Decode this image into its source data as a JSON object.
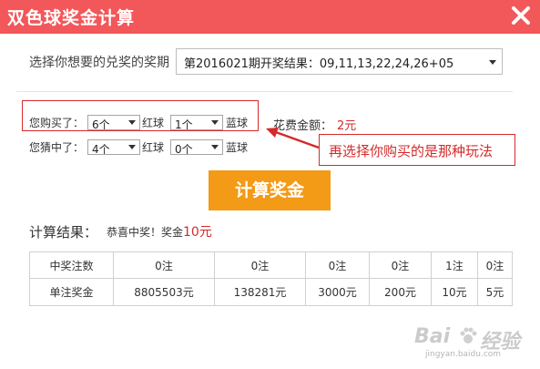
{
  "dialog": {
    "title": "双色球奖金计算",
    "close_icon": "close-icon"
  },
  "period": {
    "label": "选择你想要的兑奖的奖期",
    "selected": "第2016021期开奖结果：09,11,13,22,24,26+05"
  },
  "bought": {
    "label": "您购买了：",
    "red_value": "6个",
    "red_unit": "红球",
    "blue_value": "1个",
    "blue_unit": "蓝球"
  },
  "matched": {
    "label": "您猜中了：",
    "red_value": "4个",
    "red_unit": "红球",
    "blue_value": "0个",
    "blue_unit": "蓝球"
  },
  "cost": {
    "label": "花费金额：",
    "value": "2元"
  },
  "annotation": {
    "text": "再选择你购买的是那种玩法",
    "color": "#d62a2a"
  },
  "calculate_button": {
    "label": "计算奖金",
    "color": "#f39a16"
  },
  "result": {
    "label": "计算结果：",
    "message": "恭喜中奖！奖金",
    "amount": "10元"
  },
  "prize_table": {
    "rows": [
      {
        "header": "中奖注数",
        "cells": [
          "0注",
          "0注",
          "0注",
          "0注",
          "1注",
          "0注"
        ]
      },
      {
        "header": "单注奖金",
        "cells": [
          "8805503元",
          "138281元",
          "3000元",
          "200元",
          "10元",
          "5元"
        ]
      }
    ]
  },
  "watermark": {
    "brand": "Bai",
    "brand_suffix": "经验",
    "url": "jingyan.baidu.com"
  },
  "colors": {
    "title_bar": "#f2575a",
    "accent_red": "#d62a2a"
  }
}
